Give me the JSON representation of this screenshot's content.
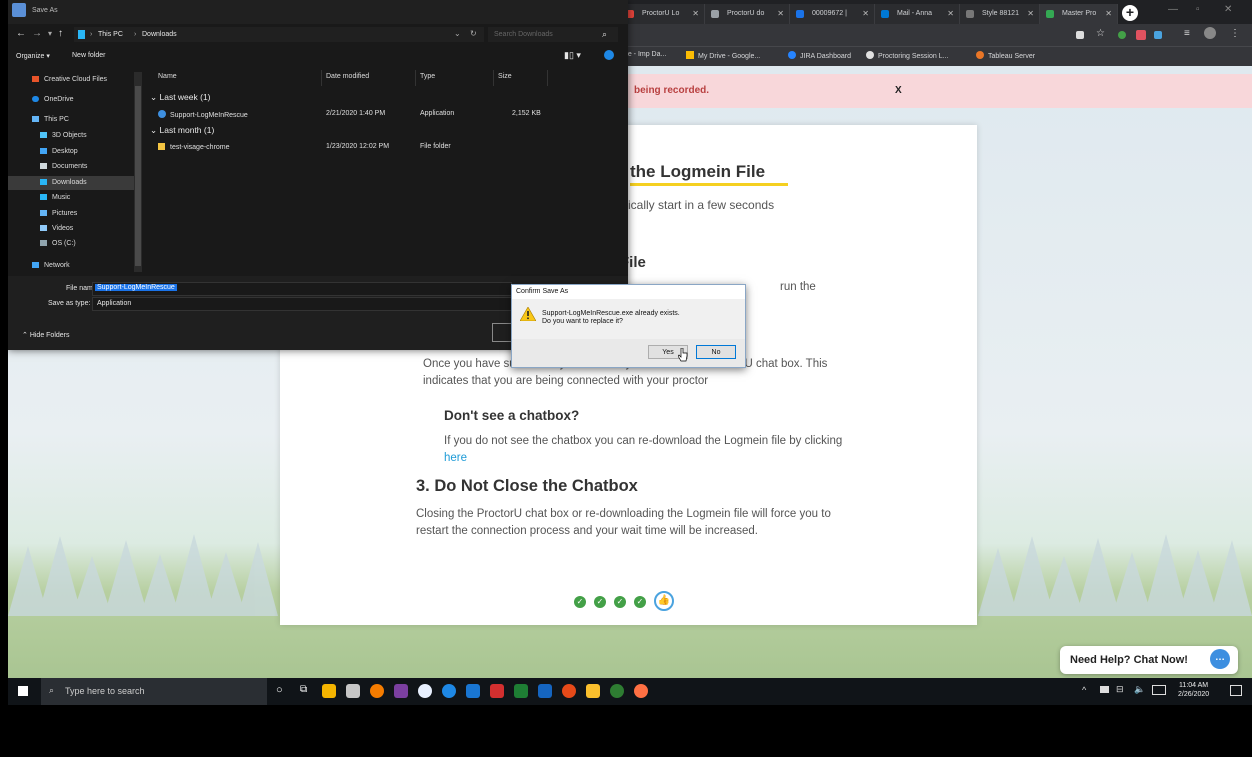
{
  "browser": {
    "tabs": [
      {
        "label": "ProctorU Lo",
        "color": "#e8453c"
      },
      {
        "label": "ProctorU do",
        "color": "#9aa0a6"
      },
      {
        "label": "00009672 |",
        "color": "#1a73e8"
      },
      {
        "label": "Mail - Anna",
        "color": "#0078d4"
      },
      {
        "label": "Style 88121",
        "color": "#777777"
      },
      {
        "label": "Master Pro",
        "color": "#34a853"
      }
    ],
    "bookmarks": [
      "rce - Imp Da...",
      "My Drive - Google...",
      "JIRA Dashboard",
      "Proctoring Session L...",
      "Tableau Server"
    ]
  },
  "page": {
    "banner_text": "being recorded.",
    "banner_close": "X",
    "heading_partial": "the Logmein File",
    "subtext_partial": "atically start in a few seconds",
    "section2_partial": "File",
    "section2_text_partial": "run the",
    "connected_text": "Once you have successfully run the file you will see the ProctorU chat box. This indicates that you are being connected with your proctor",
    "chatbox_heading": "Don't see a chatbox?",
    "chatbox_text": "If you do not see the chatbox you can re-download the Logmein file by clicking",
    "chatbox_link": "here",
    "section3_heading": "3. Do Not Close the Chatbox",
    "section3_text": "Closing the ProctorU chat box or re-downloading the Logmein file will force you to restart the connection process and your wait time will be increased.",
    "progress_steps_done": 4,
    "chat_button": "Need Help? Chat Now!"
  },
  "explorer": {
    "title": "Save As",
    "path": [
      "This PC",
      "Downloads"
    ],
    "search_placeholder": "Search Downloads",
    "organize_label": "Organize ▾",
    "new_folder_label": "New folder",
    "sidebar": [
      {
        "label": "Creative Cloud Files",
        "color": "#e8542a"
      },
      {
        "label": "OneDrive",
        "color": "#1e88e5"
      },
      {
        "label": "This PC",
        "color": "#64b5f6"
      },
      {
        "label": "3D Objects",
        "color": "#4fc3f7"
      },
      {
        "label": "Desktop",
        "color": "#42a5f5"
      },
      {
        "label": "Documents",
        "color": "#cfd8dc"
      },
      {
        "label": "Downloads",
        "color": "#29b6f6"
      },
      {
        "label": "Music",
        "color": "#29b6f6"
      },
      {
        "label": "Pictures",
        "color": "#64b5f6"
      },
      {
        "label": "Videos",
        "color": "#90caf9"
      },
      {
        "label": "OS (C:)",
        "color": "#90a4ae"
      },
      {
        "label": "Network",
        "color": "#42a5f5"
      }
    ],
    "columns": [
      "Name",
      "Date modified",
      "Type",
      "Size"
    ],
    "group1": "Last week (1)",
    "file1": {
      "name": "Support-LogMeInRescue",
      "date": "2/21/2020 1:40 PM",
      "type": "Application",
      "size": "2,152 KB"
    },
    "group2": "Last month (1)",
    "file2": {
      "name": "test-visage-chrome",
      "date": "1/23/2020 12:02 PM",
      "type": "File folder",
      "size": ""
    },
    "file_name_label": "File name:",
    "file_name_value": "Support-LogMeInRescue",
    "save_type_label": "Save as type:",
    "save_type_value": "Application",
    "hide_folders": "Hide Folders"
  },
  "confirm": {
    "title": "Confirm Save As",
    "message_line1": "Support-LogMeInRescue.exe already exists.",
    "message_line2": "Do you want to replace it?",
    "yes": "Yes",
    "no": "No"
  },
  "taskbar": {
    "search_placeholder": "Type here to search",
    "time": "11:04 AM",
    "date": "2/26/2020"
  }
}
